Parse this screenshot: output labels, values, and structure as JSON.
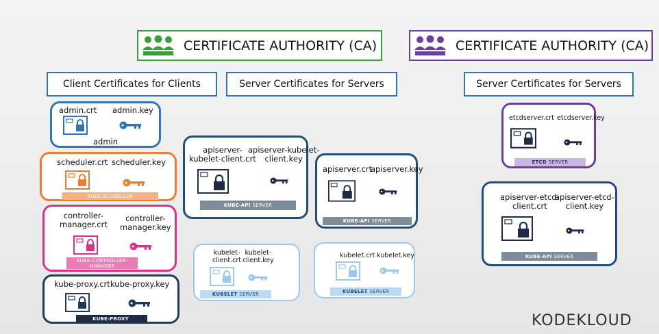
{
  "ca": [
    {
      "title": "CERTIFICATE AUTHORITY (CA)",
      "color": "#3a9d3a",
      "icon": "people-icon"
    },
    {
      "title": "CERTIFICATE AUTHORITY (CA)",
      "color": "#6b3fa0",
      "icon": "people-icon"
    }
  ],
  "headers": {
    "client": "Client Certificates for Clients",
    "server1": "Server Certificates for Servers",
    "server2": "Server Certificates for Servers"
  },
  "groups": {
    "admin": {
      "color": "#2e75b6",
      "crt": "admin.crt",
      "key": "admin.key",
      "name": "admin"
    },
    "scheduler": {
      "color": "#ed7d31",
      "crt": "scheduler.crt",
      "key": "scheduler.key",
      "bar": "KUBE-SCHEDULER"
    },
    "controller": {
      "color": "#d6338a",
      "crt_l1": "controller-",
      "crt_l2": "manager.crt",
      "key_l1": "controller-",
      "key_l2": "manager.key",
      "bar_l1": "KUBE-CONTROLLER-",
      "bar_l2": "MANAGER"
    },
    "proxy": {
      "color": "#1f3b57",
      "crt": "kube-proxy.crt",
      "key": "kube-proxy.key",
      "bar": "KUBE-PROXY"
    },
    "api1": {
      "color": "#1f4e79",
      "crt_l1": "apiserver-",
      "crt_l2": "kubelet-client.crt",
      "key_l1": "apiserver-kubelet-",
      "key_l2": "client.key",
      "bar_bold": "KUBE-API",
      "bar_rest": "SERVER"
    },
    "api2": {
      "color": "#1f4e79",
      "crt": "apiserver.crt",
      "key": "apiserver.key",
      "bar_bold": "KUBE-API",
      "bar_rest": "SERVER"
    },
    "kubelet1": {
      "color": "#9dc8ec",
      "crt_l1": "kubelet-",
      "crt_l2": "client.crt",
      "key_l1": "kubelet-",
      "key_l2": "client.key",
      "bar_bold": "KUBELET",
      "bar_rest": "SERVER"
    },
    "kubelet2": {
      "color": "#9dc8ec",
      "crt": "kubelet.crt",
      "key": "kubelet.key",
      "bar_bold": "KUBELET",
      "bar_rest": "SERVER"
    },
    "etcd": {
      "color": "#6b3fa0",
      "crt": "etcdserver.crt",
      "key": "etcdserver.key",
      "bar_bold": "ETCD",
      "bar_rest": "SERVER"
    },
    "api3": {
      "color": "#1f4e79",
      "crt_l1": "apiserver-etcd-",
      "crt_l2": "client.crt",
      "key_l1": "apiserver-etcd-",
      "key_l2": "client.key",
      "bar_bold": "KUBE-API",
      "bar_rest": "SERVER"
    }
  },
  "brand": "KODEKLOUD"
}
